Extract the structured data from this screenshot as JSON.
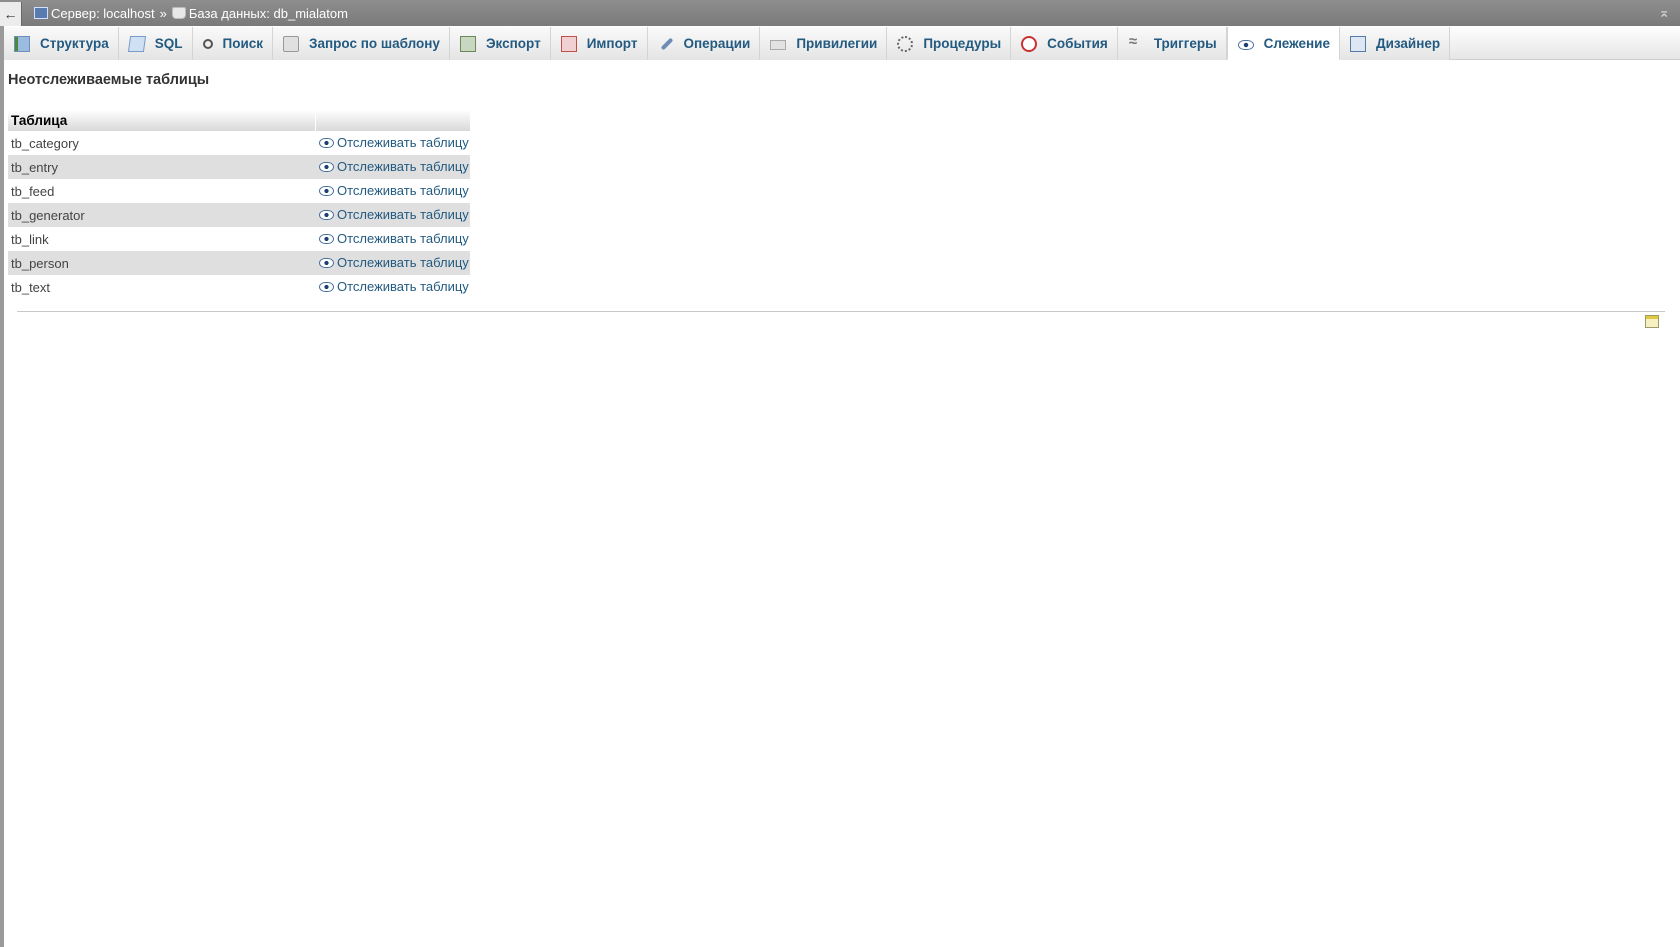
{
  "breadcrumb": {
    "back_symbol": "←",
    "server_label": "Сервер: localhost",
    "separator": "»",
    "database_label": "База данных: db_mialatom",
    "collapse_symbol": "⌅"
  },
  "tabs": [
    {
      "label": "Структура",
      "icon": "structure-icon"
    },
    {
      "label": "SQL",
      "icon": "sql-icon"
    },
    {
      "label": "Поиск",
      "icon": "search-icon"
    },
    {
      "label": "Запрос по шаблону",
      "icon": "query-icon"
    },
    {
      "label": "Экспорт",
      "icon": "export-icon"
    },
    {
      "label": "Импорт",
      "icon": "import-icon"
    },
    {
      "label": "Операции",
      "icon": "wrench-icon"
    },
    {
      "label": "Привилегии",
      "icon": "privileges-icon"
    },
    {
      "label": "Процедуры",
      "icon": "procedures-icon"
    },
    {
      "label": "События",
      "icon": "clock-icon"
    },
    {
      "label": "Триггеры",
      "icon": "triggers-icon"
    },
    {
      "label": "Слежение",
      "icon": "eye-icon",
      "active": true
    },
    {
      "label": "Дизайнер",
      "icon": "designer-icon"
    }
  ],
  "main": {
    "section_title": "Неотслеживаемые таблицы",
    "table": {
      "headers": [
        "Таблица",
        ""
      ],
      "rows": [
        {
          "name": "tb_category",
          "action": "Отслеживать таблицу"
        },
        {
          "name": "tb_entry",
          "action": "Отслеживать таблицу"
        },
        {
          "name": "tb_feed",
          "action": "Отслеживать таблицу"
        },
        {
          "name": "tb_generator",
          "action": "Отслеживать таблицу"
        },
        {
          "name": "tb_link",
          "action": "Отслеживать таблицу"
        },
        {
          "name": "tb_person",
          "action": "Отслеживать таблицу"
        },
        {
          "name": "tb_text",
          "action": "Отслеживать таблицу"
        }
      ]
    }
  },
  "colors": {
    "link": "#235a81",
    "topbar": "#868686",
    "row_stripe": "#dfdfdf"
  }
}
